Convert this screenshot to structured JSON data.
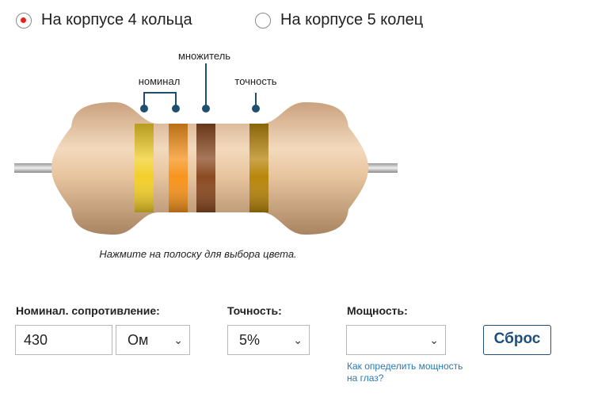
{
  "mode_options": [
    {
      "label": "На корпусе 4 кольца",
      "selected": true
    },
    {
      "label": "На корпусе 5 колец",
      "selected": false
    }
  ],
  "annotations": {
    "nominal": "номинал",
    "multiplier": "множитель",
    "tolerance": "точность"
  },
  "bands": [
    {
      "name": "band-1",
      "color": "#f2cf2b"
    },
    {
      "name": "band-2",
      "color": "#f7941d"
    },
    {
      "name": "band-3",
      "color": "#8b4a22"
    },
    {
      "name": "band-4",
      "color": "#b8860b"
    }
  ],
  "hint": "Нажмите на полоску для выбора цвета.",
  "form": {
    "nominal_label": "Номинал. сопротивление:",
    "nominal_value": "430",
    "unit_value": "Ом",
    "tolerance_label": "Точность:",
    "tolerance_value": "5%",
    "power_label": "Мощность:",
    "power_value": "",
    "reset_label": "Сброс",
    "power_help_link": "Как определить мощность на глаз?"
  },
  "icons": {
    "dropdown": "chevron-down-icon"
  }
}
